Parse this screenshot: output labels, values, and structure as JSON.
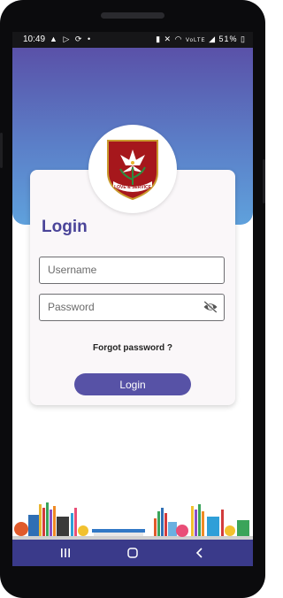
{
  "status_bar": {
    "time": "10:49",
    "left_icons": [
      "warning-icon",
      "play-store-icon",
      "sync-icon",
      "dot-icon"
    ],
    "right_icons": [
      "battery-saver-icon",
      "mute-icon",
      "wifi-icon",
      "signal-icon"
    ],
    "network_label": "VoLTE",
    "battery": "51%"
  },
  "login": {
    "title": "Login",
    "username_placeholder": "Username",
    "password_placeholder": "Password",
    "forgot_password": "Forgot password ?",
    "button_label": "Login"
  },
  "logo": {
    "motto": "LOVE & SERVICE",
    "shield_color": "#a6171c"
  },
  "nav": {
    "icons": [
      "recents-icon",
      "home-icon",
      "back-icon"
    ]
  },
  "colors": {
    "primary": "#5752a6",
    "header_top": "#5a51a8",
    "header_bottom": "#5fa1dc"
  }
}
